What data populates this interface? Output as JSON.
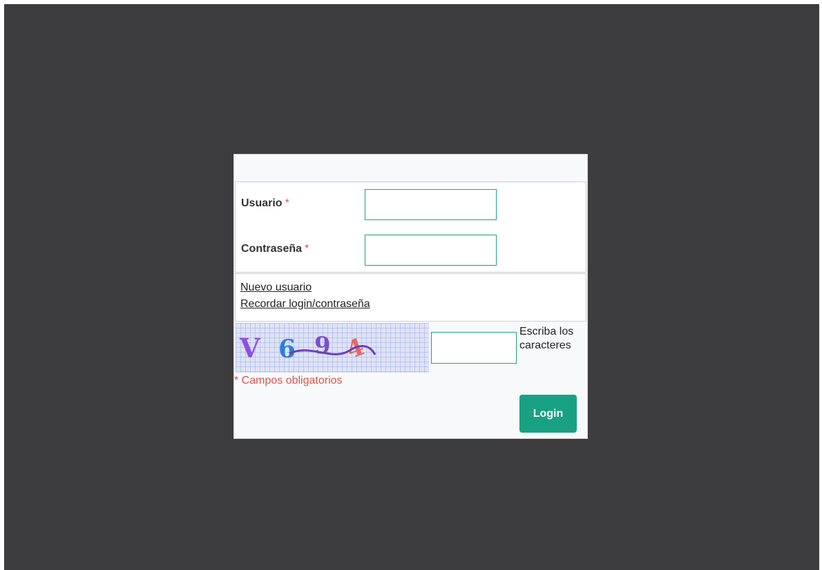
{
  "form": {
    "username_label": "Usuario",
    "password_label": "Contraseña",
    "required_mark": "*",
    "username_value": "",
    "password_value": ""
  },
  "links": {
    "new_user": "Nuevo usuario",
    "remember": "Recordar login/contraseña"
  },
  "captcha": {
    "image_text": "V 6 9 4",
    "input_value": "",
    "hint": "Escriba los caracteres"
  },
  "required_note": "* Campos obligatorios",
  "login_button": "Login",
  "colors": {
    "backdrop": "#3d3d3f",
    "accent": "#19a184",
    "required": "#d9534f"
  }
}
